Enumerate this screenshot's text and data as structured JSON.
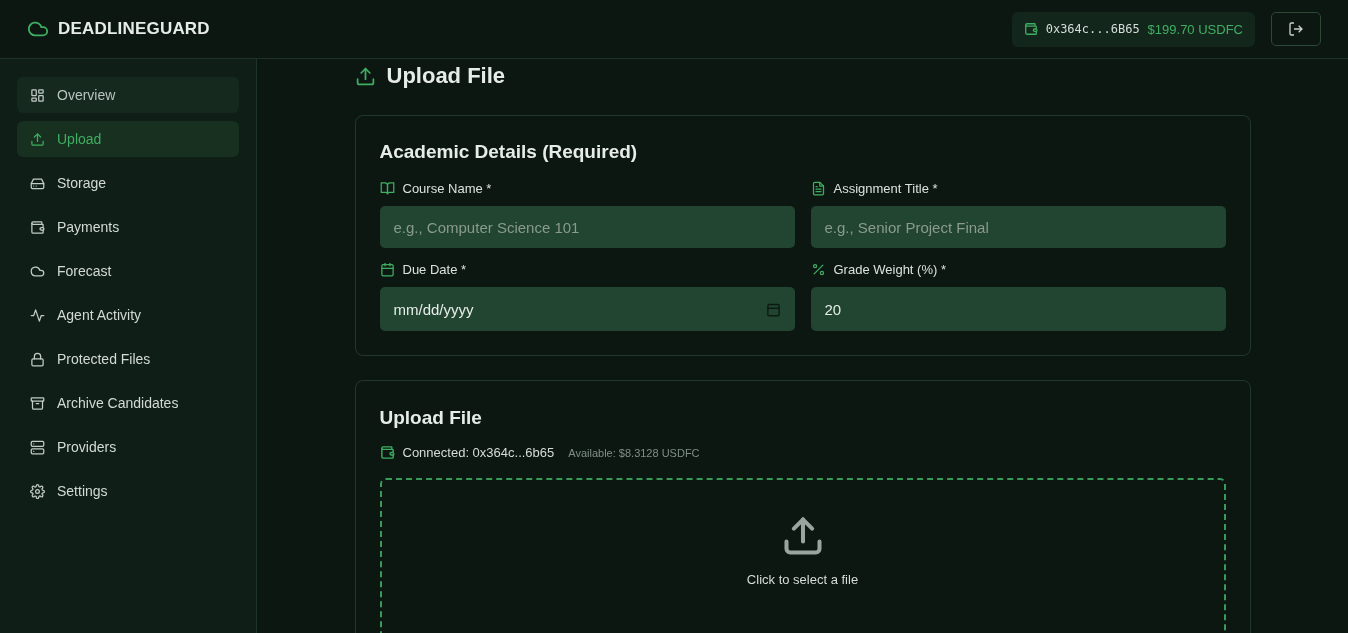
{
  "header": {
    "brand": "DEADLINEGUARD",
    "wallet": {
      "address": "0x364c...6B65",
      "balance": "$199.70 USDFC"
    }
  },
  "sidebar": {
    "items": [
      {
        "label": "Overview",
        "selected": false,
        "hovered": true
      },
      {
        "label": "Upload",
        "selected": true,
        "hovered": false
      },
      {
        "label": "Storage",
        "selected": false,
        "hovered": false
      },
      {
        "label": "Payments",
        "selected": false,
        "hovered": false
      },
      {
        "label": "Forecast",
        "selected": false,
        "hovered": false
      },
      {
        "label": "Agent Activity",
        "selected": false,
        "hovered": false
      },
      {
        "label": "Protected Files",
        "selected": false,
        "hovered": false
      },
      {
        "label": "Archive Candidates",
        "selected": false,
        "hovered": false
      },
      {
        "label": "Providers",
        "selected": false,
        "hovered": false
      },
      {
        "label": "Settings",
        "selected": false,
        "hovered": false
      }
    ]
  },
  "page_title": "Upload File",
  "academic": {
    "title": "Academic Details (Required)",
    "fields": [
      {
        "kind": "text",
        "label": "Course Name *",
        "placeholder": "e.g., Computer Science 101"
      },
      {
        "kind": "text",
        "label": "Assignment Title *",
        "placeholder": "e.g., Senior Project Final"
      },
      {
        "kind": "date",
        "label": "Due Date *",
        "value": "mm/dd/yyyy"
      },
      {
        "kind": "number",
        "label": "Grade Weight (%) *",
        "value": "20"
      }
    ]
  },
  "upload": {
    "title": "Upload File",
    "connected": "Connected: 0x364c...6b65",
    "available": "Available: $8.3128 USDFC",
    "dropzone_text": "Click to select a file"
  }
}
